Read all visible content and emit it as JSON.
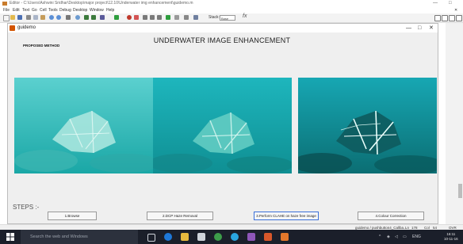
{
  "editor": {
    "title": "Editor - C:\\Users\\Ashwini Sridhar\\Desktop\\major project\\12.10\\Underwater img enhancement\\guidemo.m",
    "minimize_glyph": "—",
    "restore_glyph": "□",
    "menu": [
      "File",
      "Edit",
      "Text",
      "Go",
      "Cell",
      "Tools",
      "Debug",
      "Desktop",
      "Window",
      "Help"
    ],
    "stack_label": "Stack:",
    "stack_value": "Base",
    "fx_label": "fx"
  },
  "guidemo": {
    "window_title": "guidemo",
    "minimize_glyph": "—",
    "maximize_glyph": "□",
    "close_glyph": "✕",
    "main_title": "UNDERWATER IMAGE ENHANCEMENT",
    "subtitle": "PROPOSED METHOD",
    "steps_label": "STEPS :-",
    "buttons": [
      {
        "label": "1.Browse"
      },
      {
        "label": "2.DCP Haze Removal"
      },
      {
        "label": "3.Perform CLAHE on haze free image"
      },
      {
        "label": "4.Colour Correction"
      }
    ]
  },
  "statusbar": {
    "func": "guidemo / pushbutton4_Callba...",
    "ln_label": "Ln",
    "ln": "178",
    "col_label": "Col",
    "col": "54",
    "ovr": "OVR"
  },
  "taskbar": {
    "search_placeholder": "Search the web and Windows",
    "lang": "ENG",
    "time": "16:11",
    "date": "10-11-16"
  },
  "colors": {
    "taskbar": "#1b1f2a",
    "window_bg": "#efefef",
    "active_button_border": "#3a6fd8"
  }
}
